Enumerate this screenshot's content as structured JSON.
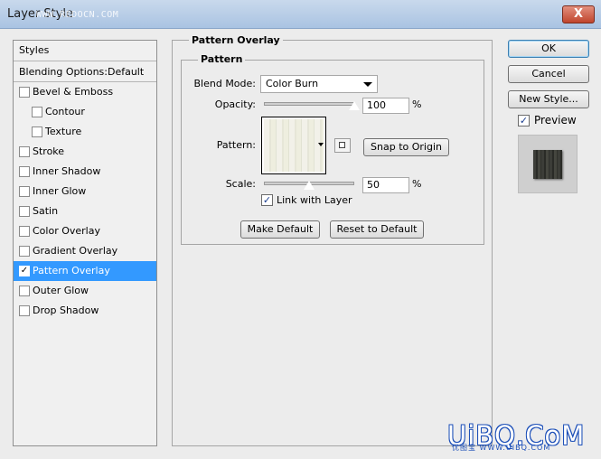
{
  "window": {
    "title": "Layer Style",
    "watermark_top": "WWW.REDOCN.COM",
    "close_glyph": "X"
  },
  "styles_list": {
    "header": "Styles",
    "blending": "Blending Options:Default",
    "items": [
      {
        "label": "Bevel & Emboss",
        "checked": false,
        "sub": false
      },
      {
        "label": "Contour",
        "checked": false,
        "sub": true
      },
      {
        "label": "Texture",
        "checked": false,
        "sub": true
      },
      {
        "label": "Stroke",
        "checked": false,
        "sub": false
      },
      {
        "label": "Inner Shadow",
        "checked": false,
        "sub": false
      },
      {
        "label": "Inner Glow",
        "checked": false,
        "sub": false
      },
      {
        "label": "Satin",
        "checked": false,
        "sub": false
      },
      {
        "label": "Color Overlay",
        "checked": false,
        "sub": false
      },
      {
        "label": "Gradient Overlay",
        "checked": false,
        "sub": false
      },
      {
        "label": "Pattern Overlay",
        "checked": true,
        "sub": false,
        "selected": true
      },
      {
        "label": "Outer Glow",
        "checked": false,
        "sub": false
      },
      {
        "label": "Drop Shadow",
        "checked": false,
        "sub": false
      }
    ]
  },
  "pattern_overlay": {
    "section_title": "Pattern Overlay",
    "group_title": "Pattern",
    "blend_mode_label": "Blend Mode:",
    "blend_mode_value": "Color Burn",
    "opacity_label": "Opacity:",
    "opacity_value": "100",
    "opacity_unit": "%",
    "opacity_level": 1.0,
    "pattern_label": "Pattern:",
    "snap_button": "Snap to Origin",
    "scale_label": "Scale:",
    "scale_value": "50",
    "scale_unit": "%",
    "scale_level": 0.5,
    "link_label": "Link with Layer",
    "link_checked": true,
    "make_default": "Make Default",
    "reset_default": "Reset to Default"
  },
  "right_panel": {
    "ok": "OK",
    "cancel": "Cancel",
    "new_style": "New Style...",
    "preview_label": "Preview",
    "preview_checked": true
  },
  "watermark": {
    "big": "UiBQ.CoM",
    "small": "优图宝 WWW.UIBQ.COM"
  }
}
